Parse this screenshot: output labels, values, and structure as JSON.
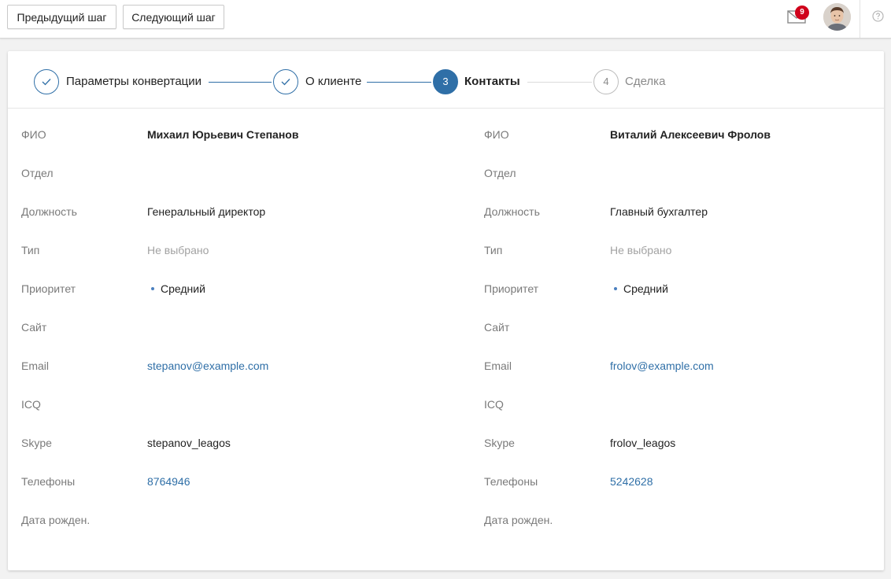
{
  "toolbar": {
    "prev_label": "Предыдущий шаг",
    "next_label": "Следующий шаг",
    "mail_count": "9"
  },
  "stepper": {
    "steps": [
      {
        "label": "Параметры конвертации",
        "state": "done",
        "icon": "check-icon"
      },
      {
        "label": "О клиенте",
        "state": "done",
        "icon": "check-icon"
      },
      {
        "label": "Контакты",
        "state": "active",
        "number": "3"
      },
      {
        "label": "Сделка",
        "state": "todo",
        "number": "4"
      }
    ]
  },
  "labels": {
    "fio": "ФИО",
    "dept": "Отдел",
    "position": "Должность",
    "type": "Тип",
    "priority": "Приоритет",
    "site": "Сайт",
    "email": "Email",
    "icq": "ICQ",
    "skype": "Skype",
    "phones": "Телефоны",
    "birth": "Дата рожден."
  },
  "contacts": [
    {
      "fio": "Михаил Юрьевич Степанов",
      "dept": "",
      "position": "Генеральный директор",
      "type": "Не выбрано",
      "priority": "Средний",
      "site": "",
      "email": "stepanov@example.com",
      "icq": "",
      "skype": "stepanov_leagos",
      "phones": "8764946",
      "birth": ""
    },
    {
      "fio": "Виталий Алексеевич Фролов",
      "dept": "",
      "position": "Главный бухгалтер",
      "type": "Не выбрано",
      "priority": "Средний",
      "site": "",
      "email": "frolov@example.com",
      "icq": "",
      "skype": "frolov_leagos",
      "phones": "5242628",
      "birth": ""
    }
  ],
  "colors": {
    "accent": "#2f6fa7",
    "badge": "#d0021b"
  }
}
